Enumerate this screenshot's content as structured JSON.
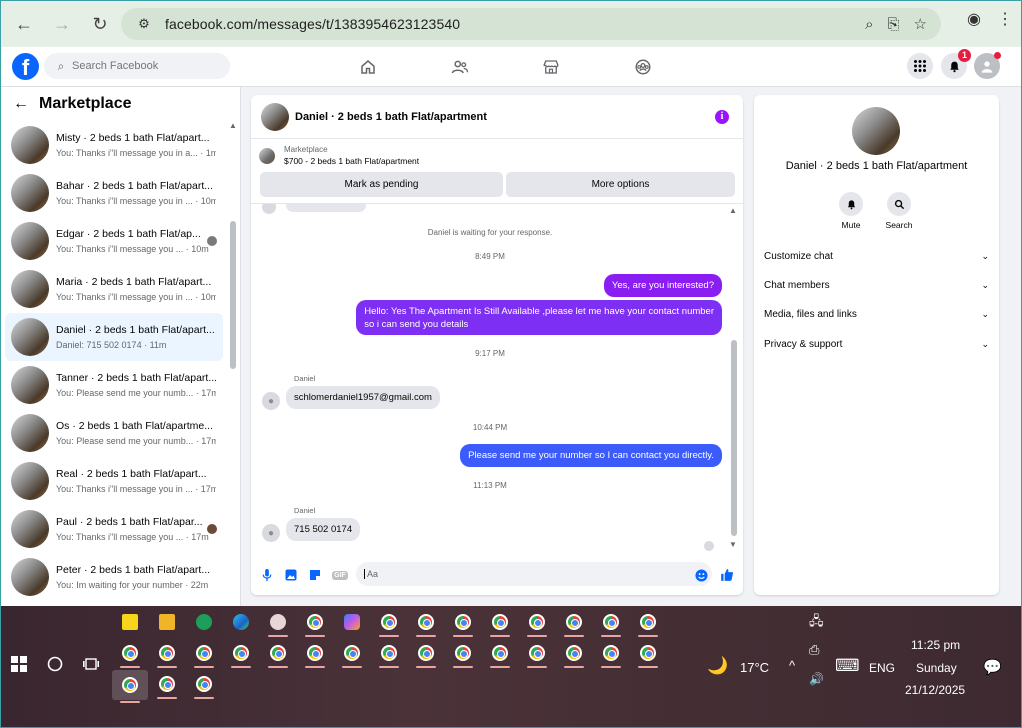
{
  "browser": {
    "url": "facebook.com/messages/t/1383954623123540",
    "back_icon": "←",
    "forward_icon": "→",
    "reload_icon": "↻",
    "tune_icon": "⚙",
    "zoom_icon": "⌕",
    "install_icon": "⎘",
    "star_icon": "☆",
    "profile_icon": "◉",
    "menu_icon": "⋮"
  },
  "fb": {
    "logo_letter": "f",
    "search_placeholder": "Search Facebook",
    "search_icon": "⌕",
    "notif_count": "1",
    "grid_icon": "⊞",
    "bell_icon": "🔔",
    "home_icon": "⌂",
    "friends_icon": "👥",
    "marketplace_icon": "🏪",
    "groups_icon": "☺"
  },
  "sidebar": {
    "back_icon": "←",
    "title": "Marketplace",
    "conversations": [
      {
        "name": "Misty · 2 beds 1 bath Flat/apart...",
        "preview": "You: Thanks i\"ll message you in a... · 1m"
      },
      {
        "name": "Bahar · 2 beds 1 bath Flat/apart...",
        "preview": "You: Thanks i\"ll message you in ... · 10m"
      },
      {
        "name": "Edgar · 2 beds 1 bath Flat/ap...",
        "preview": "You: Thanks i\"ll message you ... · 10m"
      },
      {
        "name": "Maria · 2 beds 1 bath Flat/apart...",
        "preview": "You: Thanks i\"ll message you in ... · 10m"
      },
      {
        "name": "Daniel · 2 beds 1 bath Flat/apart...",
        "preview": "Daniel: 715 502 0174 · 11m"
      },
      {
        "name": "Tanner · 2 beds 1 bath Flat/apart...",
        "preview": "You: Please send me your numb... · 17m"
      },
      {
        "name": "Os · 2 beds 1 bath Flat/apartme...",
        "preview": "You: Please send me your numb... · 17m"
      },
      {
        "name": "Real · 2 beds 1 bath Flat/apart...",
        "preview": "You: Thanks i\"ll message you in ... · 17m"
      },
      {
        "name": "Paul · 2 beds 1 bath Flat/apar...",
        "preview": "You: Thanks i\"ll message you ... · 17m"
      },
      {
        "name": "Peter · 2 beds 1 bath Flat/apart...",
        "preview": "You: Im waiting for your number · 22m"
      }
    ]
  },
  "chat": {
    "title": "Daniel · 2 beds 1 bath Flat/apartment",
    "info_icon": "i",
    "marketplace_label": "Marketplace",
    "price_line": "$700 - 2 beds 1 bath Flat/apartment",
    "mark_pending": "Mark as pending",
    "more_options": "More options",
    "waiting_note": "Daniel is waiting for your response.",
    "time_1": "8:49 PM",
    "out_1": "Yes, are you interested?",
    "out_2_line1": "Hello: Yes The Apartment Is Still Available ,please let me have your contact number",
    "out_2_line2": "so i can send you details",
    "time_2": "9:17 PM",
    "sender_1": "Daniel",
    "in_1": "schlomerdaniel1957@gmail.com",
    "time_3": "10:44 PM",
    "out_3": "Please send me your number so I can contact you directly.",
    "time_4": "11:13 PM",
    "sender_2": "Daniel",
    "in_2": "715 502 0174",
    "composer_placeholder": "Aa",
    "mic_icon": "🎙",
    "image_icon": "▣",
    "sticker_icon": "◧",
    "gif_label": "GIF",
    "emoji_icon": "☺",
    "like_icon": "👍",
    "colors": {
      "outgoing_purple": "#8a1df2",
      "outgoing_blue": "#3b5bfb",
      "accent": "#0866ff"
    }
  },
  "details": {
    "name": "Daniel · 2 beds 1 bath Flat/apartment",
    "mute_label": "Mute",
    "mute_icon": "🔔",
    "search_label": "Search",
    "search_icon": "⌕",
    "rows": [
      "Customize chat",
      "Chat members",
      "Media, files and links",
      "Privacy & support"
    ],
    "chevron": "⌄"
  },
  "taskbar": {
    "start_icon": "⊞",
    "search_icon": "○",
    "taskview_icon": "⧉",
    "temp": "17°C",
    "weather_icon": "🌙",
    "lang": "ENG",
    "time": "11:25 pm",
    "day": "Sunday",
    "date": "21/12/2025",
    "notif_icon": "💬",
    "chevron_icon": "^",
    "network_icon": "🖧",
    "sound_icon": "🔊",
    "keyboard_icon": "⌨"
  }
}
